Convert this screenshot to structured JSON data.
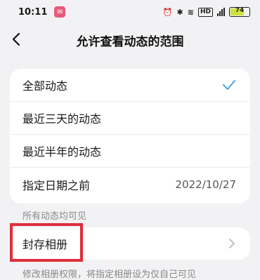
{
  "status_bar": {
    "time": "10:11",
    "network_badge": "HD",
    "battery": "74",
    "icons": [
      "notification-icon",
      "alarm-icon",
      "bluetooth-icon",
      "wifi-icon",
      "signal-icon",
      "battery-icon"
    ],
    "battery_color": "#cfe13a"
  },
  "header": {
    "title": "允许查看动态的范围",
    "back_icon": "chevron-left-icon"
  },
  "range_options": [
    {
      "label": "全部动态",
      "selected": true,
      "value": ""
    },
    {
      "label": "最近三天的动态",
      "selected": false,
      "value": ""
    },
    {
      "label": "最近半年的动态",
      "selected": false,
      "value": ""
    },
    {
      "label": "指定日期之前",
      "selected": false,
      "value": "2022/10/27"
    }
  ],
  "range_note": "所有动态均可见",
  "archive": {
    "label": "封存相册",
    "note": "修改相册权限，将指定相册设为仅自己可见"
  },
  "colors": {
    "check": "#4aa3df",
    "highlight": "#e02d3c",
    "background": "#f2f2f4"
  }
}
